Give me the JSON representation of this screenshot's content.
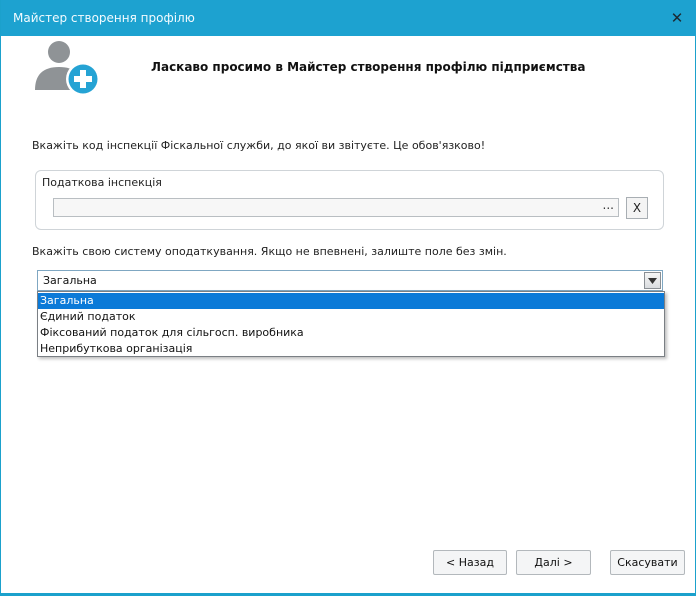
{
  "window": {
    "title": "Майстер створення профілю",
    "close_glyph": "✕"
  },
  "header": {
    "welcome": "Ласкаво просимо в Майстер створення профілю підприємства",
    "icon": "add-user-icon"
  },
  "tax_office": {
    "hint": "Вкажіть код інспекції Фіскальної служби, до якої ви звітуєте. Це обов'язково!",
    "group_label": "Податкова інспекція",
    "value": "",
    "browse_glyph": "...",
    "clear_label": "X"
  },
  "tax_system": {
    "hint": "Вкажіть свою систему оподаткування. Якщо не впевнені, залиште поле без змін.",
    "selected": "Загальна",
    "options": [
      "Загальна",
      "Єдиний податок",
      "Фіксований податок для сільгосп. виробника",
      "Неприбуткова організація"
    ]
  },
  "buttons": {
    "back": "< Назад",
    "next": "Далі >",
    "cancel": "Скасувати"
  },
  "colors": {
    "accent": "#1da2d0",
    "selection": "#0b7ad8",
    "icon_gray": "#8f9396",
    "icon_plus_bg": "#25a3d4"
  }
}
